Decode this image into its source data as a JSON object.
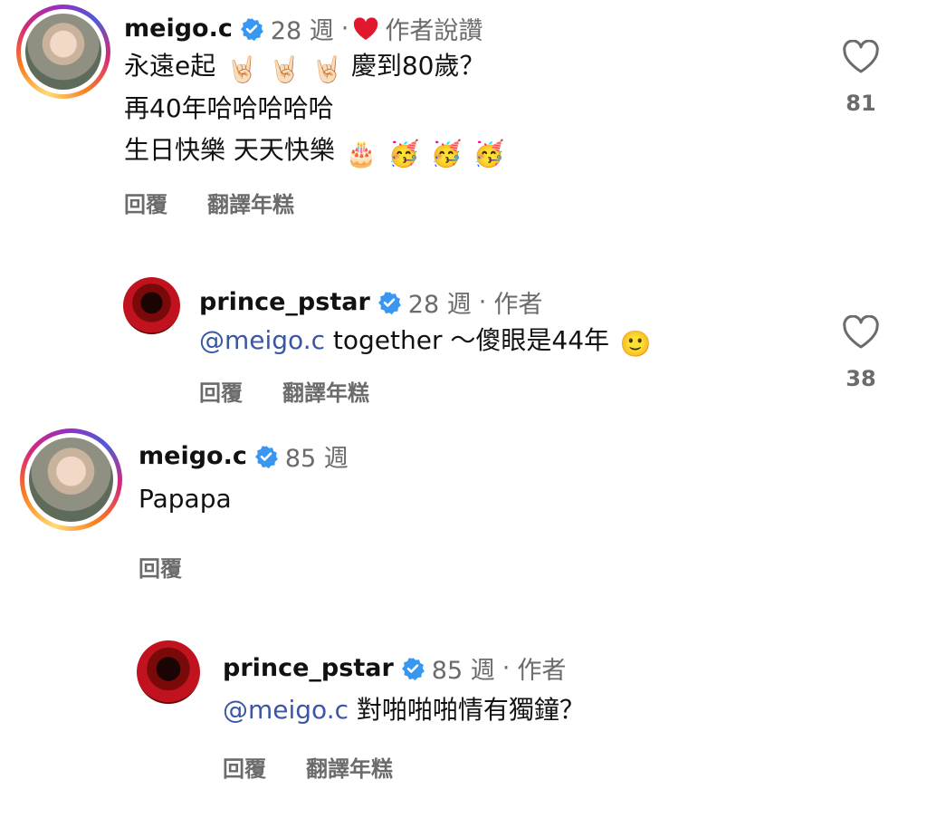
{
  "comments": [
    {
      "username": "meigo.c",
      "time": "28 週",
      "dot": "·",
      "liked_by_author": "作者說讚",
      "lines": [
        "永遠e起",
        "慶到80歲？",
        "再40年哈哈哈哈哈",
        "生日快樂 天天快樂"
      ],
      "emoji": {
        "rock": "🤘🏻",
        "cake": "🎂",
        "party": "🥳"
      },
      "actions": {
        "reply": "回覆",
        "translate": "翻譯年糕"
      },
      "likes": "81"
    },
    {
      "username": "prince_pstar",
      "time": "28 週",
      "dot": "·",
      "author_tag": "作者",
      "mention": "@meigo.c",
      "text": "together ～傻眼是44年",
      "emoji": {
        "smile": "🙂"
      },
      "actions": {
        "reply": "回覆",
        "translate": "翻譯年糕"
      },
      "likes": "38"
    },
    {
      "username": "meigo.c",
      "time": "85 週",
      "text": "Papapa",
      "actions": {
        "reply": "回覆"
      }
    },
    {
      "username": "prince_pstar",
      "time": "85 週",
      "dot": "·",
      "author_tag": "作者",
      "mention": "@meigo.c",
      "text": "對啪啪啪情有獨鐘？",
      "actions": {
        "reply": "回覆",
        "translate": "翻譯年糕"
      }
    }
  ],
  "colors": {
    "verified": "#3897f0",
    "mention": "#3a56a5",
    "author_heart": "#e0182d",
    "meta": "#6b6b6b"
  },
  "icons": {
    "verified": "verified-badge-icon",
    "like": "heart-outline-icon",
    "author_like": "heart-filled-icon"
  }
}
